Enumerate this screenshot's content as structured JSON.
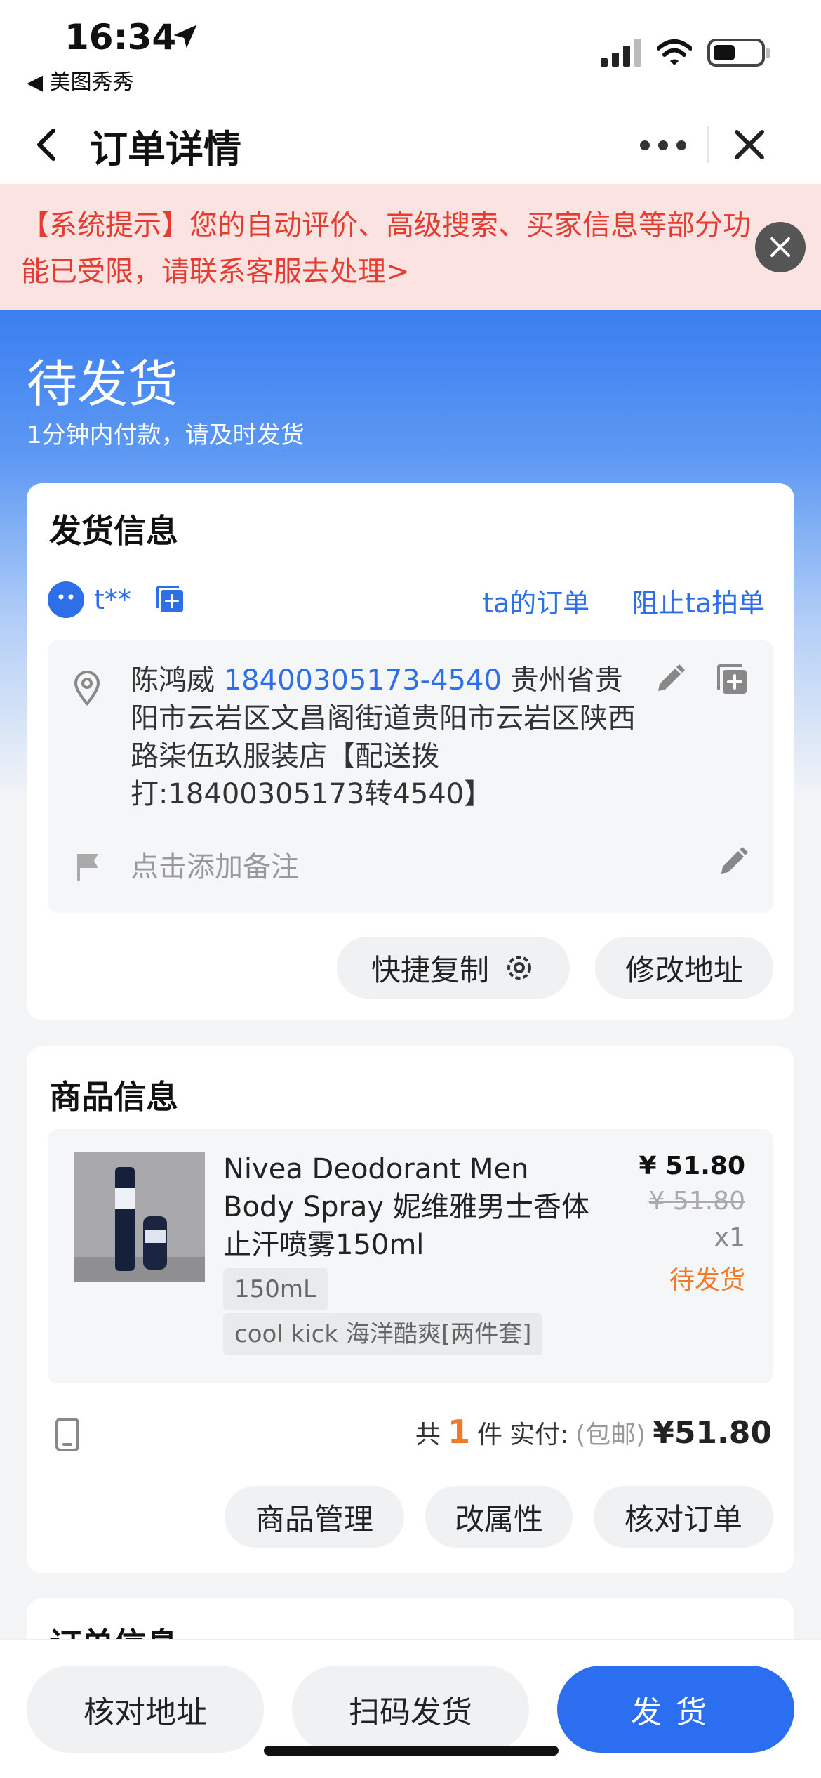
{
  "status_bar": {
    "time": "16:34",
    "back_app": "◀ 美图秀秀"
  },
  "nav": {
    "title": "订单详情"
  },
  "notice": {
    "text": "【系统提示】您的自动评价、高级搜索、买家信息等部分功能已受限，请联系客服去处理>"
  },
  "header": {
    "status": "待发货",
    "subtitle": "1分钟内付款，请及时发货"
  },
  "shipping": {
    "title": "发货信息",
    "buyer": "t**",
    "link_orders": "ta的订单",
    "link_block": "阻止ta拍单",
    "name": "陈鸿威",
    "phone": "18400305173-4540",
    "address": "贵州省贵阳市云岩区文昌阁街道贵阳市云岩区陕西路柒伍玖服装店【配送拨打:18400305173转4540】",
    "note_placeholder": "点击添加备注",
    "quick_copy": "快捷复制",
    "edit_address": "修改地址"
  },
  "goods": {
    "title": "商品信息",
    "name": "Nivea Deodorant Men Body Spray 妮维雅男士香体止汗喷雾150ml",
    "spec1": "150mL",
    "spec2": "cool kick 海洋酷爽[两件套]",
    "price": "¥ 51.80",
    "original_price": "¥ 51.80",
    "qty": "x1",
    "status": "待发货",
    "total_prefix": "共",
    "total_count": "1",
    "total_unit": "件",
    "paid_label": "实付:",
    "shipping_note": "(包邮)",
    "paid_amount": "¥51.80",
    "btn_manage": "商品管理",
    "btn_attr": "改属性",
    "btn_verify": "核对订单"
  },
  "order_info": {
    "title": "订单信息"
  },
  "bottom": {
    "verify_address": "核对地址",
    "scan_ship": "扫码发货",
    "ship": "发货"
  },
  "colors": {
    "accent": "#2b6ef0",
    "warning": "#e53c32",
    "orange": "#ef7a2a"
  }
}
